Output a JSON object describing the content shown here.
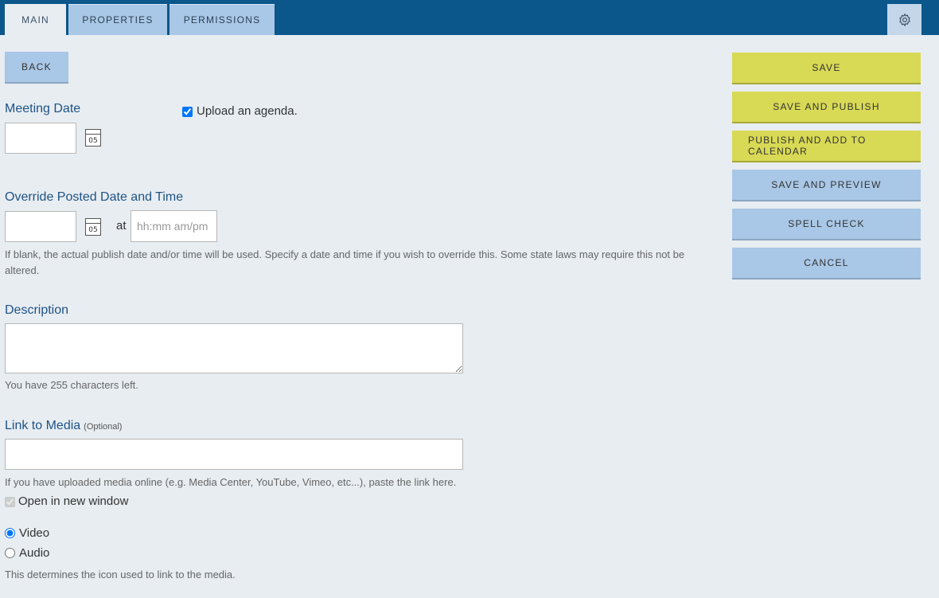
{
  "tabs": [
    {
      "label": "MAIN"
    },
    {
      "label": "PROPERTIES"
    },
    {
      "label": "PERMISSIONS"
    }
  ],
  "icons": {
    "settings": "gear-icon",
    "calendar": "calendar-icon"
  },
  "actions": {
    "back": "BACK",
    "save": "SAVE",
    "save_publish": "SAVE AND PUBLISH",
    "publish_calendar": "PUBLISH AND ADD TO CALENDAR",
    "save_preview": "SAVE AND PREVIEW",
    "spell_check": "SPELL CHECK",
    "cancel": "CANCEL"
  },
  "meeting_date": {
    "label": "Meeting Date",
    "value": "",
    "calendar_day": "05"
  },
  "upload_agenda": {
    "label": "Upload an agenda.",
    "checked": true
  },
  "override": {
    "label": "Override Posted Date and Time",
    "date_value": "",
    "calendar_day": "05",
    "at_label": "at",
    "time_placeholder": "hh:mm am/pm",
    "help": "If blank, the actual publish date and/or time will be used. Specify a date and time if you wish to override this. Some state laws may require this not be altered."
  },
  "description": {
    "label": "Description",
    "value": "",
    "counter": "You have 255 characters left."
  },
  "media": {
    "label": "Link to Media",
    "optional": "(Optional)",
    "value": "",
    "help": "If you have uploaded media online (e.g. Media Center, YouTube, Vimeo, etc...), paste the link here.",
    "new_window_label": "Open in new window",
    "new_window_checked": true,
    "type_options": [
      {
        "label": "Video",
        "selected": true
      },
      {
        "label": "Audio",
        "selected": false
      }
    ],
    "type_help": "This determines the icon used to link to the media."
  },
  "colors": {
    "header": "#0b568a",
    "tab": "#a9c7e6",
    "yellow": "#d8d955",
    "label": "#1e5386",
    "background": "#e8edf1"
  }
}
